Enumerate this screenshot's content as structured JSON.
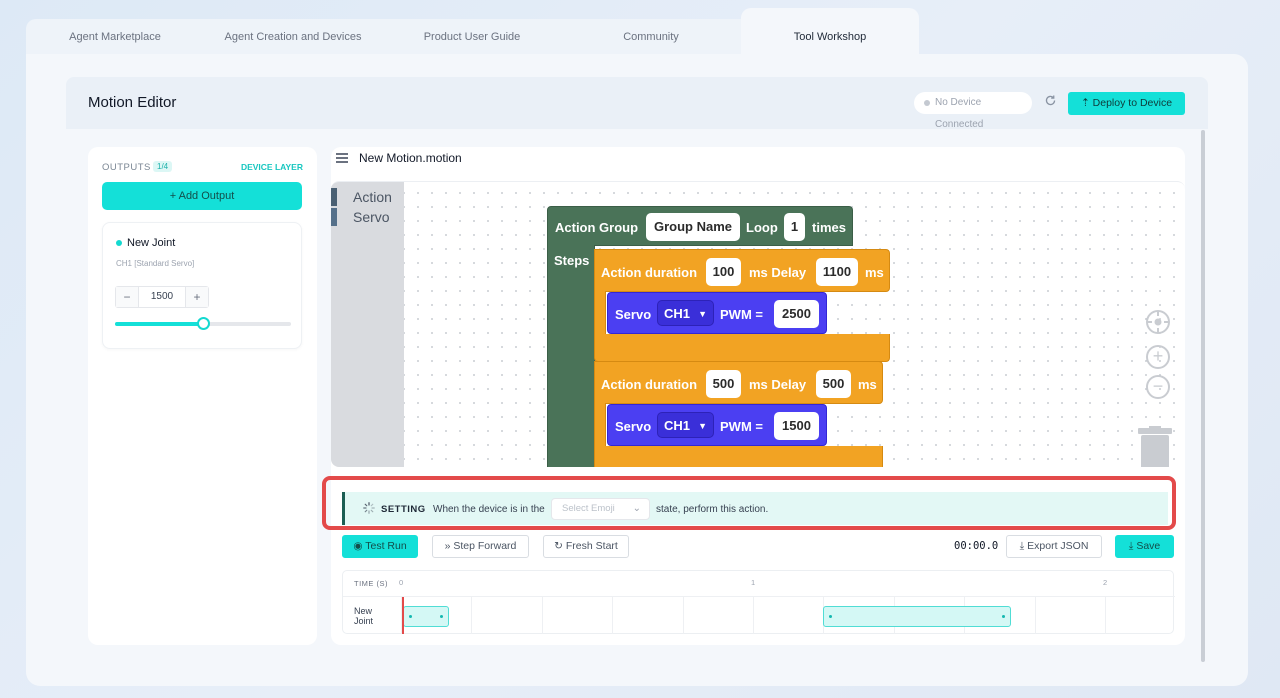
{
  "tabs": [
    {
      "label": "Agent Marketplace",
      "active": false
    },
    {
      "label": "Agent Creation and Devices",
      "active": false
    },
    {
      "label": "Product User Guide",
      "active": false
    },
    {
      "label": "Community",
      "active": false
    },
    {
      "label": "Tool Workshop",
      "active": true
    }
  ],
  "header": {
    "title": "Motion Editor",
    "device_status": "No Device Connected",
    "deploy_label": "Deploy to Device",
    "refresh_icon": "refresh-icon"
  },
  "outputs": {
    "label": "OUTPUTS",
    "count": "1/4",
    "device_layer": "DEVICE LAYER",
    "add_label": "+ Add Output",
    "joint": {
      "name": "New Joint",
      "channel": "CH1 [Standard Servo]",
      "value": "1500",
      "decrement": "−",
      "increment": "+",
      "slider_fraction": 0.5
    }
  },
  "editor": {
    "file_name": "New Motion.motion",
    "toolbox": [
      "Action",
      "Servo"
    ],
    "blocks": {
      "group_label": "Action Group",
      "group_name": "Group Name",
      "loop_label": "Loop",
      "loop_count": "1",
      "times_label": "times",
      "steps_label": "Steps",
      "actions": [
        {
          "duration_label": "Action duration",
          "duration": "100",
          "delay_label": "ms Delay",
          "delay": "1100",
          "ms_label": "ms",
          "servo_label": "Servo",
          "channel": "CH1",
          "pwm_label": "PWM =",
          "pwm": "2500"
        },
        {
          "duration_label": "Action duration",
          "duration": "500",
          "delay_label": "ms Delay",
          "delay": "500",
          "ms_label": "ms",
          "servo_label": "Servo",
          "channel": "CH1",
          "pwm_label": "PWM =",
          "pwm": "1500"
        }
      ]
    }
  },
  "setting": {
    "label": "SETTING",
    "pre_text": "When the device is in the",
    "emoji_placeholder": "Select Emoji",
    "post_text": "state, perform this action."
  },
  "controls": {
    "test_run": "Test Run",
    "step_forward": "Step Forward",
    "fresh_start": "Fresh Start",
    "time": "00:00.0",
    "export_json": "Export JSON",
    "save": "Save"
  },
  "timeline": {
    "time_label": "TIME (S)",
    "ticks": [
      "0",
      "1",
      "2"
    ],
    "track_label_line1": "New",
    "track_label_line2": "Joint"
  }
}
